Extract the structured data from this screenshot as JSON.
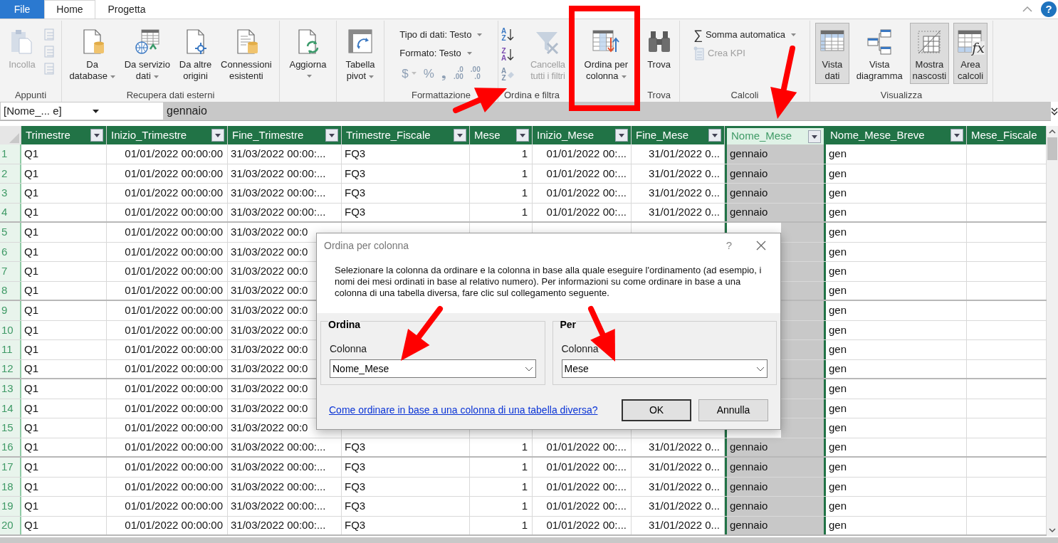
{
  "tabs": [
    {
      "label": "File",
      "kind": "file",
      "selected": false
    },
    {
      "label": "Home",
      "kind": "tab",
      "selected": true
    },
    {
      "label": "Progetta",
      "kind": "tab",
      "selected": false
    }
  ],
  "help": "?",
  "ribbon": [
    {
      "label": "Appunti",
      "items": [
        {
          "kind": "large",
          "lines": [
            "Incolla"
          ],
          "dropdown": false,
          "disabled": true
        },
        {
          "kind": "clipstack",
          "disabled": true
        }
      ]
    },
    {
      "label": "Recupera dati esterni",
      "items": [
        {
          "kind": "large",
          "lines": [
            "Da",
            "database"
          ],
          "dropdown": true,
          "disabled": false
        },
        {
          "kind": "large",
          "lines": [
            "Da servizio",
            "dati"
          ],
          "dropdown": true,
          "disabled": false
        },
        {
          "kind": "large",
          "lines": [
            "Da altre",
            "origini"
          ],
          "dropdown": false,
          "disabled": false
        },
        {
          "kind": "large",
          "lines": [
            "Connessioni",
            "esistenti"
          ],
          "dropdown": false,
          "disabled": false
        }
      ]
    },
    {
      "items": [
        {
          "kind": "large",
          "lines": [
            "Aggiorna"
          ],
          "dropdown": true,
          "disabled": false
        }
      ]
    },
    {
      "items": [
        {
          "kind": "large",
          "lines": [
            "Tabella",
            "pivot"
          ],
          "dropdown": true,
          "disabled": false
        }
      ]
    },
    {
      "label": "Formattazione",
      "items": [
        {
          "kind": "small",
          "text": "Tipo di dati: Testo",
          "dropdown": true,
          "disabled": false
        },
        {
          "kind": "small",
          "text": "Formato: Testo",
          "dropdown": true,
          "disabled": false
        },
        {
          "kind": "symbols",
          "disabled": true,
          "symbols": [
            {
              "text": "$",
              "dropdown": true
            },
            {
              "text": "%",
              "dropdown": false
            },
            {
              "text": "❟",
              "dropdown": false
            },
            {
              "top": ".0",
              "bottom": ".00"
            },
            {
              "top": ".00",
              "bottom": ".0"
            }
          ]
        }
      ]
    },
    {
      "label": "Ordina e filtra",
      "items": [
        {
          "kind": "sortstack",
          "buttons": [
            {
              "top": "A",
              "bottom": "Z",
              "disabled": false
            },
            {
              "top": "Z",
              "bottom": "A",
              "disabled": false
            },
            {
              "top": "A",
              "bottom": "Z",
              "disabled": true
            }
          ]
        },
        {
          "kind": "large",
          "lines": [
            "Cancella",
            "tutti i filtri"
          ],
          "dropdown": false,
          "disabled": true
        },
        {
          "kind": "large",
          "lines": [
            "Ordina per",
            "colonna"
          ],
          "dropdown": true,
          "disabled": false
        }
      ]
    },
    {
      "label": "Trova",
      "items": [
        {
          "kind": "large",
          "lines": [
            "Trova"
          ],
          "dropdown": false,
          "disabled": false
        }
      ]
    },
    {
      "label": "Calcoli",
      "items": [
        {
          "kind": "small",
          "icon_text": "∑",
          "text": "Somma automatica",
          "dropdown": true,
          "disabled": false
        },
        {
          "kind": "small",
          "text": "Crea KPI",
          "dropdown": false,
          "disabled": true
        }
      ]
    },
    {
      "label": "Visualizza",
      "items": [
        {
          "kind": "large",
          "lines": [
            "Vista",
            "dati"
          ],
          "dropdown": false,
          "disabled": false,
          "selected": true
        },
        {
          "kind": "large",
          "lines": [
            "Vista",
            "diagramma"
          ],
          "dropdown": false,
          "disabled": false,
          "selected": false
        },
        {
          "kind": "large",
          "lines": [
            "Mostra",
            "nascosti"
          ],
          "dropdown": false,
          "disabled": false,
          "selected": true
        },
        {
          "kind": "large",
          "lines": [
            "Area",
            "calcoli"
          ],
          "icon_text": "fx",
          "dropdown": false,
          "disabled": false,
          "selected": true
        }
      ]
    }
  ],
  "formula_bar": {
    "name_box": "[Nome_... e]",
    "formula": "gennaio"
  },
  "table": {
    "columns": [
      {
        "name": "Trimestre",
        "selected": false
      },
      {
        "name": "Inizio_Trimestre",
        "selected": false
      },
      {
        "name": "Fine_Trimestre",
        "selected": false
      },
      {
        "name": "Trimestre_Fiscale",
        "selected": false
      },
      {
        "name": "Mese",
        "selected": false
      },
      {
        "name": "Inizio_Mese",
        "selected": false
      },
      {
        "name": "Fine_Mese",
        "selected": false
      },
      {
        "name": "Nome_Mese",
        "selected": true
      },
      {
        "name": "Nome_Mese_Breve",
        "selected": false
      },
      {
        "name": "Mese_Fiscale",
        "selected": false
      }
    ],
    "rows": [
      {
        "number": "1",
        "cells": [
          "Q1",
          "01/01/2022 00:00:00",
          "31/03/2022 00:00:...",
          "FQ3",
          "1",
          "01/01/2022 00:...",
          "31/01/2022 0...",
          "gennaio",
          "gen",
          null
        ]
      },
      {
        "number": "2",
        "cells": [
          "Q1",
          "01/01/2022 00:00:00",
          "31/03/2022 00:00:...",
          "FQ3",
          "1",
          "01/01/2022 00:...",
          "31/01/2022 0...",
          "gennaio",
          "gen",
          null
        ]
      },
      {
        "number": "3",
        "cells": [
          "Q1",
          "01/01/2022 00:00:00",
          "31/03/2022 00:00:...",
          "FQ3",
          "1",
          "01/01/2022 00:...",
          "31/01/2022 0...",
          "gennaio",
          "gen",
          null
        ]
      },
      {
        "number": "4",
        "cells": [
          "Q1",
          "01/01/2022 00:00:00",
          "31/03/2022 00:00:...",
          "FQ3",
          "1",
          "01/01/2022 00:...",
          "31/01/2022 0...",
          "gennaio",
          "gen",
          null
        ]
      },
      {
        "number": "5",
        "cells": [
          "Q1",
          "01/01/2022 00:00:00",
          "31/03/2022 00:0",
          null,
          null,
          null,
          null,
          null,
          "gen",
          null
        ]
      },
      {
        "number": "6",
        "cells": [
          "Q1",
          "01/01/2022 00:00:00",
          "31/03/2022 00:0",
          null,
          null,
          null,
          null,
          null,
          "gen",
          null
        ]
      },
      {
        "number": "7",
        "cells": [
          "Q1",
          "01/01/2022 00:00:00",
          "31/03/2022 00:0",
          null,
          null,
          null,
          null,
          null,
          "gen",
          null
        ]
      },
      {
        "number": "8",
        "cells": [
          "Q1",
          "01/01/2022 00:00:00",
          "31/03/2022 00:0",
          null,
          null,
          null,
          null,
          null,
          "gen",
          null
        ]
      },
      {
        "number": "9",
        "cells": [
          "Q1",
          "01/01/2022 00:00:00",
          "31/03/2022 00:0",
          null,
          null,
          null,
          null,
          null,
          "gen",
          null
        ]
      },
      {
        "number": "10",
        "cells": [
          "Q1",
          "01/01/2022 00:00:00",
          "31/03/2022 00:0",
          null,
          null,
          null,
          null,
          null,
          "gen",
          null
        ]
      },
      {
        "number": "11",
        "cells": [
          "Q1",
          "01/01/2022 00:00:00",
          "31/03/2022 00:0",
          null,
          null,
          null,
          null,
          null,
          "gen",
          null
        ]
      },
      {
        "number": "12",
        "cells": [
          "Q1",
          "01/01/2022 00:00:00",
          "31/03/2022 00:0",
          null,
          null,
          null,
          null,
          null,
          "gen",
          null
        ]
      },
      {
        "number": "13",
        "cells": [
          "Q1",
          "01/01/2022 00:00:00",
          "31/03/2022 00:0",
          null,
          null,
          null,
          null,
          null,
          "gen",
          null
        ]
      },
      {
        "number": "14",
        "cells": [
          "Q1",
          "01/01/2022 00:00:00",
          "31/03/2022 00:0",
          null,
          null,
          null,
          null,
          null,
          "gen",
          null
        ]
      },
      {
        "number": "15",
        "cells": [
          "Q1",
          "01/01/2022 00:00:00",
          "31/03/2022 00:0",
          null,
          null,
          null,
          null,
          null,
          "gen",
          null
        ]
      },
      {
        "number": "16",
        "cells": [
          "Q1",
          "01/01/2022 00:00:00",
          "31/03/2022 00:00:...",
          "FQ3",
          "1",
          "01/01/2022 00:...",
          "31/01/2022 0...",
          "gennaio",
          "gen",
          null
        ]
      },
      {
        "number": "17",
        "cells": [
          "Q1",
          "01/01/2022 00:00:00",
          "31/03/2022 00:00:...",
          "FQ3",
          "1",
          "01/01/2022 00:...",
          "31/01/2022 0...",
          "gennaio",
          "gen",
          null
        ]
      },
      {
        "number": "18",
        "cells": [
          "Q1",
          "01/01/2022 00:00:00",
          "31/03/2022 00:00:...",
          "FQ3",
          "1",
          "01/01/2022 00:...",
          "31/01/2022 0...",
          "gennaio",
          "gen",
          null
        ]
      },
      {
        "number": "19",
        "cells": [
          "Q1",
          "01/01/2022 00:00:00",
          "31/03/2022 00:00:...",
          "FQ3",
          "1",
          "01/01/2022 00:...",
          "31/01/2022 0...",
          "gennaio",
          "gen",
          null
        ]
      },
      {
        "number": "20",
        "cells": [
          "Q1",
          "01/01/2022 00:00:00",
          "31/03/2022 00:00:...",
          "FQ3",
          "1",
          "01/01/2022 00:...",
          "31/01/2022 0...",
          "gennaio",
          "gen",
          null
        ]
      }
    ]
  },
  "dialog": {
    "title": "Ordina per colonna",
    "help": "?",
    "description": "Selezionare la colonna da ordinare e la colonna in base alla quale eseguire l'ordinamento (ad esempio, i nomi dei mesi ordinati in base al relativo numero). Per informazioni su come ordinare in base a una colonna di una tabella diversa, fare clic sul collegamento seguente.",
    "groups": [
      {
        "title": "Ordina",
        "field_label": "Colonna",
        "value": "Nome_Mese"
      },
      {
        "title": "Per",
        "field_label": "Colonna",
        "value": "Mese"
      }
    ],
    "link": "Come ordinare in base a una colonna di una tabella diversa?",
    "buttons": [
      {
        "label": "OK",
        "default": true
      },
      {
        "label": "Annulla",
        "default": false
      }
    ]
  }
}
